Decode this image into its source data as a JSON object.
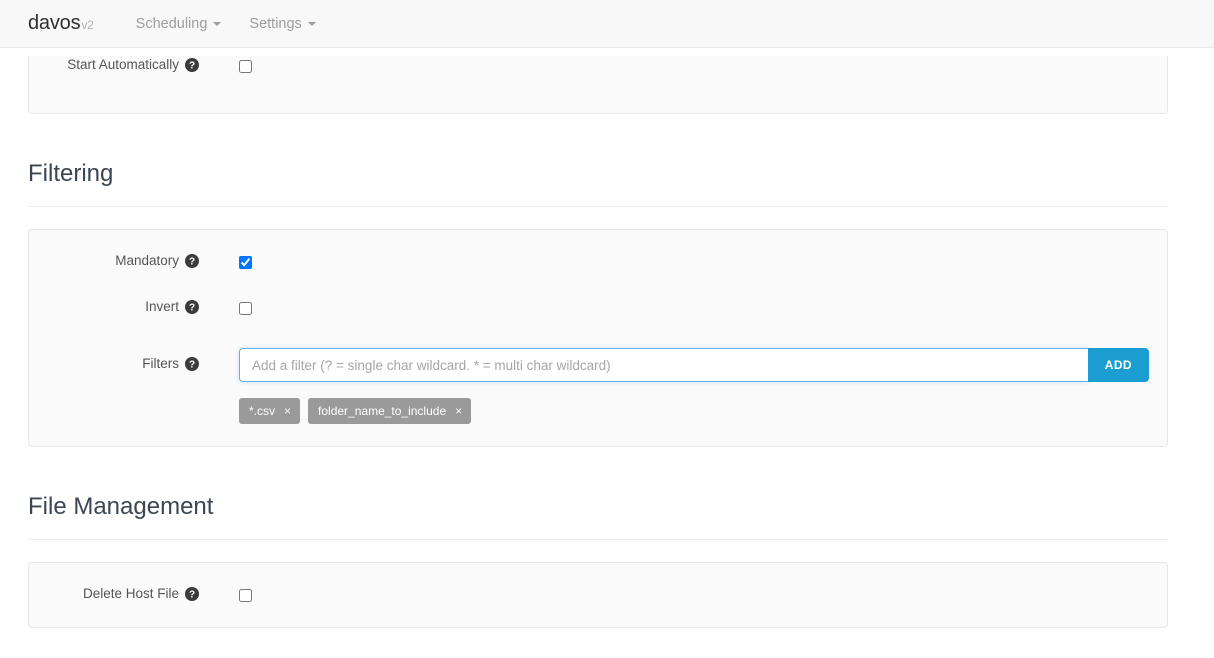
{
  "navbar": {
    "brand": "davos",
    "brand_version": "v2",
    "items": [
      {
        "label": "Scheduling",
        "has_caret": true,
        "icon": "chevron-down-icon"
      },
      {
        "label": "Settings",
        "has_caret": true,
        "icon": "chevron-down-icon"
      }
    ]
  },
  "scheduling_panel": {
    "rows": [
      {
        "label": "Start Automatically",
        "help_icon": "help-circle-icon",
        "control": "checkbox",
        "checked": false
      }
    ]
  },
  "sections": [
    {
      "title": "Filtering",
      "rows": [
        {
          "label": "Mandatory",
          "help_icon": "help-circle-icon",
          "control": "checkbox",
          "checked": true
        },
        {
          "label": "Invert",
          "help_icon": "help-circle-icon",
          "control": "checkbox",
          "checked": false
        },
        {
          "label": "Filters",
          "help_icon": "help-circle-icon",
          "control": "input-group",
          "placeholder": "Add a filter (? = single char wildcard. * = multi char wildcard)",
          "value": "",
          "button_label": "ADD",
          "tags": [
            {
              "label": "*.csv",
              "remove": "×"
            },
            {
              "label": "folder_name_to_include",
              "remove": "×"
            }
          ]
        }
      ]
    },
    {
      "title": "File Management",
      "rows": [
        {
          "label": "Delete Host File",
          "help_icon": "help-circle-icon",
          "control": "checkbox",
          "checked": false
        }
      ]
    }
  ],
  "colors": {
    "accent": "#1b9dd1",
    "focus_border": "#66afe9",
    "tag_bg": "#9a9a9a",
    "panel_bg": "#fafafa",
    "navbar_bg": "#f8f8f8",
    "heading": "#3c4653"
  }
}
